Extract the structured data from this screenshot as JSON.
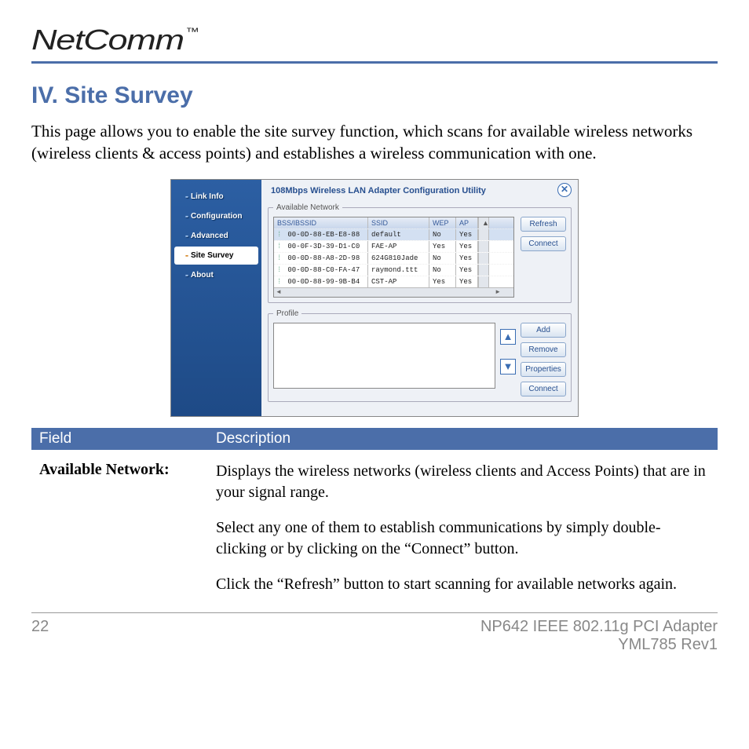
{
  "brand": "NetComm",
  "tm": "™",
  "section_title": "IV. Site Survey",
  "intro": "This page allows you to enable the site survey function, which scans for available wireless networks (wireless clients & access points) and establishes a wireless communication with one.",
  "utility": {
    "title": "108Mbps Wireless LAN Adapter Configuration Utility",
    "nav": [
      "Link Info",
      "Configuration",
      "Advanced",
      "Site Survey",
      "About"
    ],
    "active_nav": "Site Survey",
    "available_label": "Available Network",
    "columns": {
      "bss": "BSS/IBSSID",
      "ssid": "SSID",
      "wep": "WEP",
      "ap": "AP"
    },
    "rows": [
      {
        "bss": "00-0D-88-EB-E8-88",
        "ssid": "default",
        "wep": "No",
        "ap": "Yes"
      },
      {
        "bss": "00-0F-3D-39-D1-C0",
        "ssid": "FAE-AP",
        "wep": "Yes",
        "ap": "Yes"
      },
      {
        "bss": "00-0D-88-A8-2D-98",
        "ssid": "624G810Jade",
        "wep": "No",
        "ap": "Yes"
      },
      {
        "bss": "00-0D-88-C0-FA-47",
        "ssid": "raymond.ttt",
        "wep": "No",
        "ap": "Yes"
      },
      {
        "bss": "00-0D-88-99-9B-B4",
        "ssid": "CST-AP",
        "wep": "Yes",
        "ap": "Yes"
      }
    ],
    "buttons": {
      "refresh": "Refresh",
      "connect": "Connect"
    },
    "profile_label": "Profile",
    "profile_buttons": {
      "add": "Add",
      "remove": "Remove",
      "properties": "Properties",
      "connect": "Connect"
    }
  },
  "fd": {
    "head_field": "Field",
    "head_desc": "Description",
    "field_label": "Available Network:",
    "p1": "Displays the wireless networks (wireless clients and Access Points) that are in your signal range.",
    "p2": "Select any one of them to establish communications by simply double-clicking or by clicking on the “Connect” button.",
    "p3": "Click the “Refresh” button to start scanning for available networks again."
  },
  "footer": {
    "page": "22",
    "product": "NP642 IEEE 802.11g PCI Adapter",
    "rev": "YML785 Rev1"
  }
}
